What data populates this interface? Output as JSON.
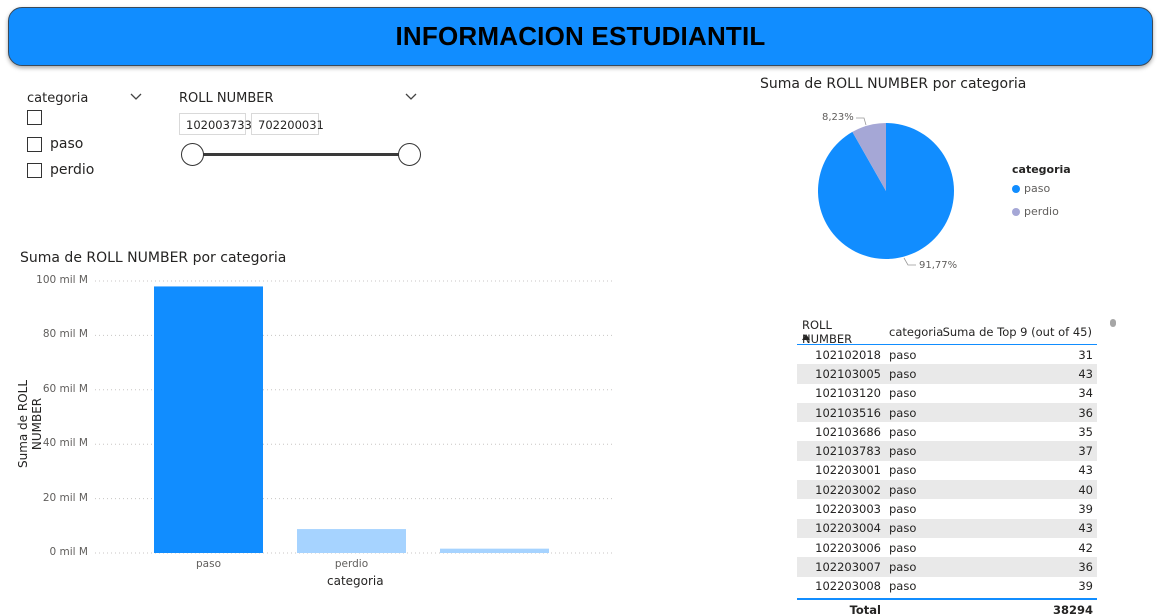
{
  "banner": {
    "title": "INFORMACION ESTUDIANTIL"
  },
  "slicer_categoria": {
    "title": "categoria",
    "options": [
      {
        "label": "",
        "checked": false
      },
      {
        "label": "paso",
        "checked": false
      },
      {
        "label": "perdio",
        "checked": false
      }
    ]
  },
  "slicer_roll": {
    "title": "ROLL NUMBER",
    "min_value": "102003733",
    "max_value": "702200031"
  },
  "colors": {
    "accent": "#118dff",
    "light_blue": "#a6d3ff",
    "lavender": "#a5a7d6"
  },
  "bar_chart": {
    "title": "Suma de ROLL NUMBER por categoria",
    "chart_data": {
      "type": "bar",
      "title": "Suma de ROLL NUMBER por categoria",
      "xlabel": "categoria",
      "ylabel": "Suma de ROLL NUMBER",
      "categories": [
        "paso",
        "perdio",
        ""
      ],
      "values": [
        98000000,
        8800000,
        1600000
      ],
      "bar_colors": [
        "#118dff",
        "#a6d3ff",
        "#a6d3ff"
      ],
      "yticks": [
        "0 mil M",
        "20 mil M",
        "40 mil M",
        "60 mil M",
        "80 mil M",
        "100 mil M"
      ],
      "ylim": [
        0,
        100000000
      ],
      "grid": true
    }
  },
  "pie_chart": {
    "title": "Suma de ROLL NUMBER por categoria",
    "legend_title": "categoria",
    "chart_data": {
      "type": "pie",
      "title": "Suma de ROLL NUMBER por categoria",
      "slices": [
        {
          "name": "paso",
          "percent": 91.77,
          "label": "91,77%",
          "color": "#118dff"
        },
        {
          "name": "perdio",
          "percent": 8.23,
          "label": "8,23%",
          "color": "#a5a7d6"
        }
      ],
      "legend": "right"
    }
  },
  "table": {
    "headers": [
      "ROLL NUMBER",
      "categoria",
      "Suma de Top 9 (out of 45)"
    ],
    "rows": [
      [
        "102102018",
        "paso",
        "31"
      ],
      [
        "102103005",
        "paso",
        "43"
      ],
      [
        "102103120",
        "paso",
        "34"
      ],
      [
        "102103516",
        "paso",
        "36"
      ],
      [
        "102103686",
        "paso",
        "35"
      ],
      [
        "102103783",
        "paso",
        "37"
      ],
      [
        "102203001",
        "paso",
        "43"
      ],
      [
        "102203002",
        "paso",
        "40"
      ],
      [
        "102203003",
        "paso",
        "39"
      ],
      [
        "102203004",
        "paso",
        "43"
      ],
      [
        "102203006",
        "paso",
        "42"
      ],
      [
        "102203007",
        "paso",
        "36"
      ],
      [
        "102203008",
        "paso",
        "39"
      ]
    ],
    "total_label": "Total",
    "total_value": "38294"
  }
}
